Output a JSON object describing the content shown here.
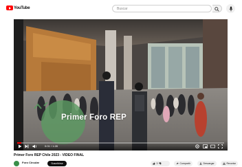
{
  "header": {
    "logo_text": "YouTube",
    "search_placeholder": "Buscar"
  },
  "video": {
    "caption": "Primer Foro REP",
    "progress_fraction": 0.02,
    "time_text": "0:01 / 1:28"
  },
  "meta": {
    "title": "Primer Foro REP Chile 2023 - VIDEO FINAL",
    "channel": "Foro Circular",
    "subscribe_label": "Suscribirse",
    "like_count": "3",
    "share_label": "Compartir",
    "download_label": "Descargar",
    "clip_label": "Recortar"
  },
  "colors": {
    "brand": "#ff0000",
    "accent_green": "#3a8f4a"
  },
  "icons": [
    "youtube-logo-icon",
    "search-icon",
    "mic-icon",
    "play-icon",
    "next-icon",
    "volume-icon",
    "settings-icon",
    "miniplayer-icon",
    "theater-icon",
    "fullscreen-icon",
    "like-icon",
    "dislike-icon",
    "share-icon",
    "download-icon",
    "clip-icon"
  ]
}
